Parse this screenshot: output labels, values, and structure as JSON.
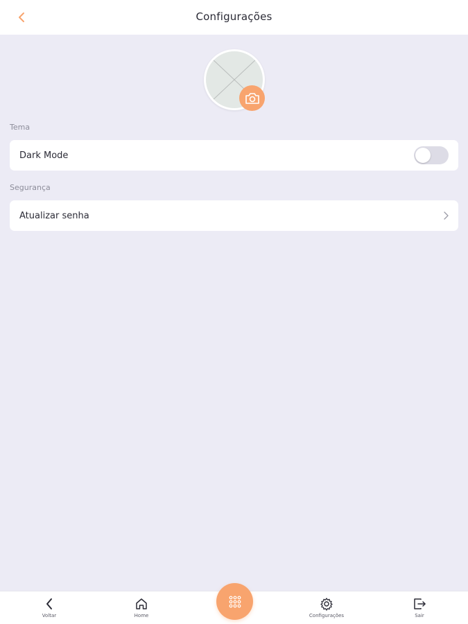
{
  "header": {
    "title": "Configurações"
  },
  "sections": {
    "theme": {
      "label": "Tema",
      "dark_mode_label": "Dark Mode",
      "dark_mode_enabled": false
    },
    "security": {
      "label": "Segurança",
      "update_password_label": "Atualizar senha"
    }
  },
  "nav": {
    "back": {
      "label": "Voltar",
      "icon": "chevron-left-icon"
    },
    "home": {
      "label": "Home",
      "icon": "home-icon"
    },
    "menu": {
      "icon": "grid-icon"
    },
    "settings": {
      "label": "Configurações",
      "icon": "gear-icon"
    },
    "logout": {
      "label": "Sair",
      "icon": "logout-icon"
    }
  },
  "colors": {
    "accent": "#f8a46e",
    "background": "#ecebf5",
    "card": "#ffffff"
  }
}
